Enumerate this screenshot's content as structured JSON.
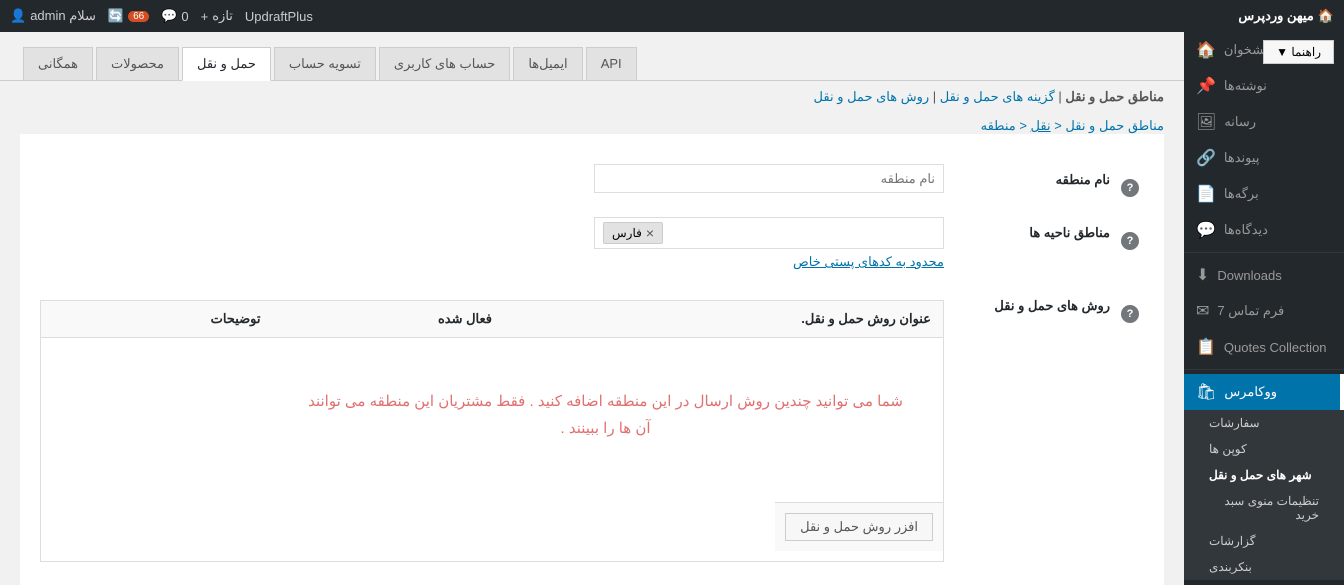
{
  "adminbar": {
    "brand": "میهن وردپرس",
    "brand_icon": "🏠",
    "user_label": "سلام admin",
    "user_icon": "👤",
    "plugin_label": "UpdraftPlus",
    "new_label": "تازه",
    "new_icon": "+",
    "comments_count": "0",
    "messages_icon": "💬",
    "updates_count": "66",
    "updates_icon": "🔄"
  },
  "help_btn": "راهنما ▼",
  "sidebar": {
    "items": [
      {
        "id": "dashboard",
        "label": "پیشخوان",
        "icon": "🏠"
      },
      {
        "id": "posts",
        "label": "نوشته‌ها",
        "icon": "📌"
      },
      {
        "id": "media",
        "label": "رسانه",
        "icon": "🖼"
      },
      {
        "id": "links",
        "label": "پیوندها",
        "icon": "🔗"
      },
      {
        "id": "pages",
        "label": "برگه‌ها",
        "icon": "📄"
      },
      {
        "id": "comments",
        "label": "دیدگاه‌ها",
        "icon": "💬"
      },
      {
        "id": "downloads",
        "label": "Downloads",
        "icon": "⬇"
      },
      {
        "id": "contact7",
        "label": "فرم تماس 7",
        "icon": "✉"
      },
      {
        "id": "quotes",
        "label": "Quotes Collection",
        "icon": "📋"
      },
      {
        "id": "woocommerce",
        "label": "ووکامرس",
        "icon": "🛍",
        "active": true
      }
    ],
    "submenu": [
      {
        "id": "orders",
        "label": "سفارشات"
      },
      {
        "id": "coupons",
        "label": "کوپن ها"
      },
      {
        "id": "shipping_zones",
        "label": "شهر های حمل و نقل",
        "active": true
      },
      {
        "id": "menu_settings",
        "label": "تنظیمات منوی سبد خرید"
      },
      {
        "id": "reports",
        "label": "گزارشات"
      },
      {
        "id": "settings",
        "label": "بنکربندی"
      }
    ]
  },
  "tabs": [
    {
      "id": "general",
      "label": "همگانی"
    },
    {
      "id": "products",
      "label": "محصولات"
    },
    {
      "id": "shipping",
      "label": "حمل و نقل",
      "active": true
    },
    {
      "id": "account",
      "label": "تسویه حساب"
    },
    {
      "id": "user_accounts",
      "label": "حساب های کاربری"
    },
    {
      "id": "emails",
      "label": "ایمیل‌ها"
    },
    {
      "id": "api",
      "label": "API"
    }
  ],
  "breadcrumb": {
    "main": "مناطق حمل و نقل",
    "separator1": " | ",
    "link1_label": "گزینه های حمل و نقل",
    "separator2": " | ",
    "link2_label": "روش های حمل و نقل"
  },
  "page_title": {
    "prefix": "مناطق حمل و نقل",
    "separator": " < ",
    "link_label": "نقل",
    "suffix": " < منطقه"
  },
  "form": {
    "zone_name_label": "نام منطقه",
    "zone_name_placeholder": "نام منطقه",
    "zone_regions_label": "مناطق ناحیه ها",
    "region_tag": "فارس",
    "restrict_link": "محدود به کدهای پستی خاص",
    "shipping_methods_label": "روش های حمل و نقل"
  },
  "methods_table": {
    "headers": [
      {
        "id": "title",
        "label": "عنوان روش حمل و نقل."
      },
      {
        "id": "enabled",
        "label": "فعال شده"
      },
      {
        "id": "description",
        "label": "توضیحات"
      }
    ],
    "empty_message_line1": "شما می توانید چندین روش ارسال در این منطقه اضافه کنید . فقط مشتریان این منطقه می توانند",
    "empty_message_line2": "آن ها را ببینند .",
    "add_button_label": "افزر روش حمل و نقل"
  }
}
